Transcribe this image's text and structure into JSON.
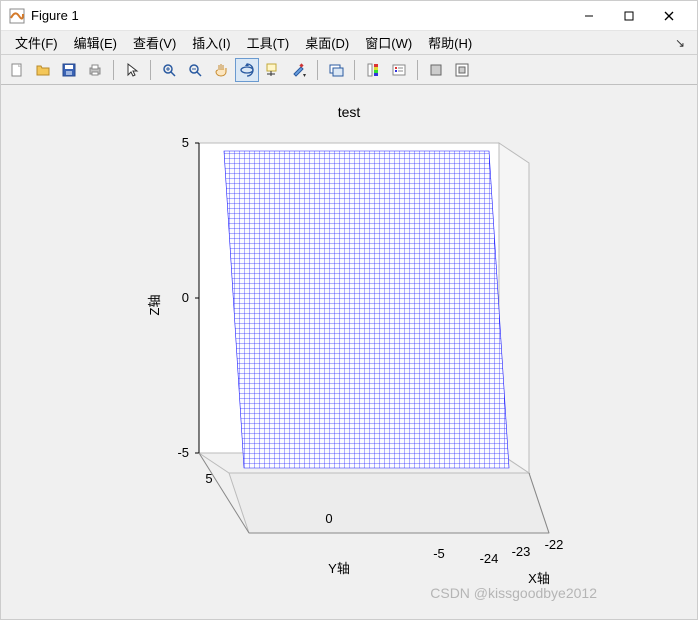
{
  "window": {
    "title": "Figure 1"
  },
  "menu": {
    "items": [
      "文件(F)",
      "编辑(E)",
      "查看(V)",
      "插入(I)",
      "工具(T)",
      "桌面(D)",
      "窗口(W)",
      "帮助(H)"
    ]
  },
  "toolbar": {
    "icons": [
      "new-figure-icon",
      "open-icon",
      "save-icon",
      "print-icon",
      "|",
      "pointer-icon",
      "|",
      "zoom-in-icon",
      "zoom-out-icon",
      "pan-icon",
      "rotate3d-icon",
      "data-cursor-icon",
      "brush-icon",
      "|",
      "link-icon",
      "|",
      "colorbar-icon",
      "legend-icon",
      "|",
      "hide-plot-tools-icon",
      "show-plot-tools-icon"
    ],
    "active": "rotate3d-icon"
  },
  "chart_data": {
    "type": "surface",
    "title": "test",
    "xlabel": "X轴",
    "ylabel": "Y轴",
    "zlabel": "Z轴",
    "x_range": [
      -24,
      -22
    ],
    "y_range": [
      -5,
      5
    ],
    "z_range": [
      -5,
      5
    ],
    "x_ticks": {
      "values": [
        -24,
        -23,
        -22
      ],
      "labels": [
        "-24",
        "-23",
        "-22"
      ]
    },
    "y_ticks": {
      "values": [
        -5,
        0,
        5
      ],
      "labels": [
        "-5",
        "0",
        "5"
      ]
    },
    "z_ticks": {
      "values": [
        -5,
        0,
        5
      ],
      "labels": [
        "-5",
        "0",
        "5"
      ]
    },
    "description": "Dense blue wireframe mesh forming a nearly-planar vertical sheet at x ≈ -23, spanning full Y (-5..5) and Z (-5..5) range."
  },
  "watermark": "CSDN @kissgoodbye2012"
}
